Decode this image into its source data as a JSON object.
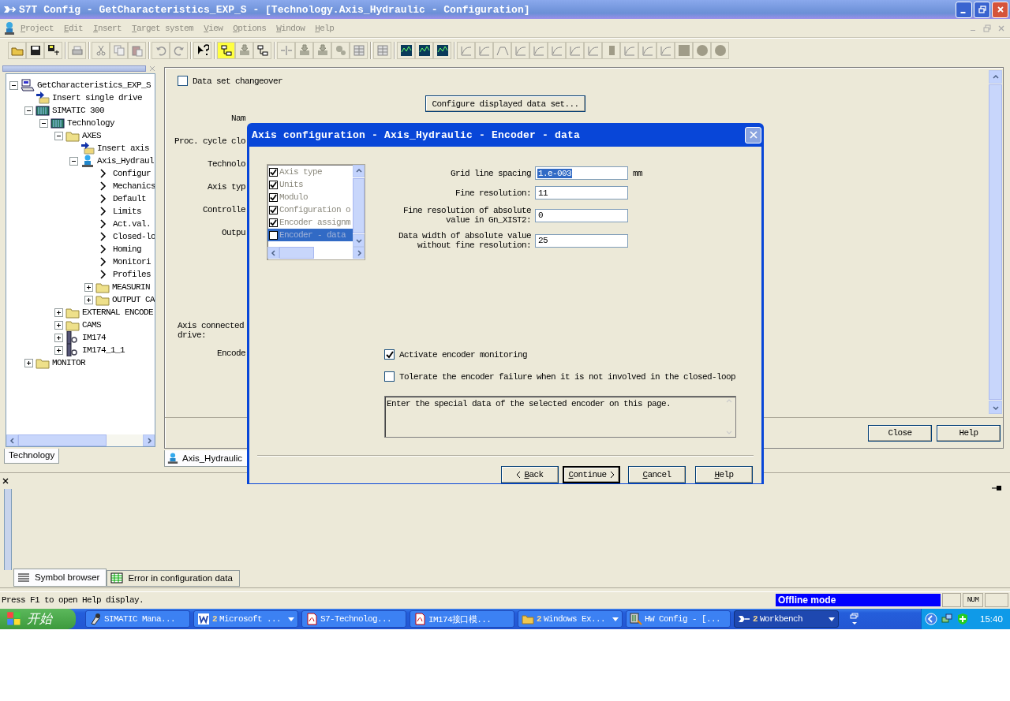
{
  "window": {
    "title": "S7T Config - GetCharacteristics_EXP_S - [Technology.Axis_Hydraulic - Configuration]"
  },
  "menu": [
    "Project",
    "Edit",
    "Insert",
    "Target system",
    "View",
    "Options",
    "Window",
    "Help"
  ],
  "tree": {
    "tab": "Technology",
    "items": [
      {
        "label": "GetCharacteristics_EXP_S",
        "kind": "project",
        "expanded": true,
        "children": [
          {
            "label": "Insert single drive",
            "kind": "insert"
          },
          {
            "label": "SIMATIC 300",
            "kind": "plc",
            "expanded": true,
            "children": [
              {
                "label": "Technology",
                "kind": "tech",
                "expanded": true,
                "children": [
                  {
                    "label": "AXES",
                    "kind": "folder",
                    "expanded": true,
                    "children": [
                      {
                        "label": "Insert axis",
                        "kind": "insert"
                      },
                      {
                        "label": "Axis_Hydraul",
                        "kind": "axis",
                        "expanded": true,
                        "children": [
                          {
                            "label": "Configur",
                            "kind": "page"
                          },
                          {
                            "label": "Mechanics",
                            "kind": "page"
                          },
                          {
                            "label": "Default",
                            "kind": "page"
                          },
                          {
                            "label": "Limits",
                            "kind": "page"
                          },
                          {
                            "label": "Act.val.",
                            "kind": "page"
                          },
                          {
                            "label": "Closed-lo",
                            "kind": "page"
                          },
                          {
                            "label": "Homing",
                            "kind": "page"
                          },
                          {
                            "label": "Monitori",
                            "kind": "page"
                          },
                          {
                            "label": "Profiles",
                            "kind": "page"
                          },
                          {
                            "label": "MEASURIN",
                            "kind": "folder",
                            "expanded": false
                          },
                          {
                            "label": "OUTPUT CA",
                            "kind": "folder",
                            "expanded": false
                          }
                        ]
                      }
                    ]
                  },
                  {
                    "label": "EXTERNAL ENCODE",
                    "kind": "folder",
                    "expanded": false
                  },
                  {
                    "label": "CAMS",
                    "kind": "folder",
                    "expanded": false
                  },
                  {
                    "label": "IM174",
                    "kind": "module",
                    "expanded": false
                  },
                  {
                    "label": "IM174_1_1",
                    "kind": "module",
                    "expanded": false
                  }
                ]
              }
            ]
          },
          {
            "label": "MONITOR",
            "kind": "folder",
            "expanded": false
          }
        ]
      }
    ]
  },
  "config": {
    "data_set_changeover": {
      "label": "Data set changeover",
      "checked": false
    },
    "configure_button": "Configure displayed data set...",
    "labels": [
      "Nam",
      "Proc. cycle clo",
      "Technolo",
      "Axis typ",
      "Controlle",
      "Outpu"
    ],
    "connected_label": "Axis connected drive:",
    "encoder_label": "Encode",
    "buttons": [
      "Close",
      "Help"
    ],
    "tab": "Axis_Hydraulic"
  },
  "dialog": {
    "title": "Axis configuration - Axis_Hydraulic - Encoder - data",
    "steps": [
      {
        "label": "Axis type",
        "checked": true,
        "selected": false
      },
      {
        "label": "Units",
        "checked": true,
        "selected": false
      },
      {
        "label": "Modulo",
        "checked": true,
        "selected": false
      },
      {
        "label": "Configuration o",
        "checked": true,
        "selected": false
      },
      {
        "label": "Encoder assignm",
        "checked": true,
        "selected": false
      },
      {
        "label": "Encoder - data",
        "checked": false,
        "selected": true
      }
    ],
    "fields": [
      {
        "label": "Grid line spacing",
        "value": "1.e-003",
        "unit": "mm",
        "text_selected": true
      },
      {
        "label": "Fine resolution:",
        "value": "11",
        "text_selected": false
      },
      {
        "label": "Fine resolution of absolute value in Gn_XIST2:",
        "value": "0",
        "text_selected": false
      },
      {
        "label": "Data width of absolute value without fine resolution:",
        "value": "25",
        "text_selected": false
      }
    ],
    "options": [
      {
        "label": "Activate encoder monitoring",
        "checked": true
      },
      {
        "label": "Tolerate the encoder failure when it is not involved in the closed-loop",
        "checked": false
      }
    ],
    "info": "Enter the special data of the selected encoder on this page.",
    "buttons": [
      {
        "label": "Back",
        "kind": "back",
        "default": false
      },
      {
        "label": "Continue",
        "kind": "continue",
        "default": true
      },
      {
        "label": "Cancel",
        "kind": "plain",
        "default": false
      },
      {
        "label": "Help",
        "kind": "plain",
        "default": false
      }
    ]
  },
  "lower_tabs": [
    {
      "label": "Symbol browser",
      "selected": true
    },
    {
      "label": "Error in configuration data",
      "selected": false
    }
  ],
  "status": {
    "text": "Press F1 to open Help display.",
    "mode": "Offline mode",
    "num": "NUM"
  },
  "taskbar": {
    "start": "开始",
    "tasks": [
      {
        "label": "SIMATIC Mana...",
        "grouped": false,
        "selected": false,
        "kind": "tool"
      },
      {
        "count": "2",
        "label": "Microsoft ...",
        "grouped": true,
        "selected": false,
        "kind": "word"
      },
      {
        "label": "S7-Technolog...",
        "grouped": false,
        "selected": false,
        "kind": "pdf"
      },
      {
        "label": "IM174接口模...",
        "grouped": false,
        "selected": false,
        "kind": "pdf"
      },
      {
        "count": "2",
        "label": "Windows Ex...",
        "grouped": true,
        "selected": false,
        "kind": "folder"
      },
      {
        "label": "HW Config - [...",
        "grouped": false,
        "selected": false,
        "kind": "hw"
      },
      {
        "count": "2",
        "label": "Workbench",
        "grouped": true,
        "selected": true,
        "kind": "app"
      }
    ],
    "clock": "15:40"
  }
}
